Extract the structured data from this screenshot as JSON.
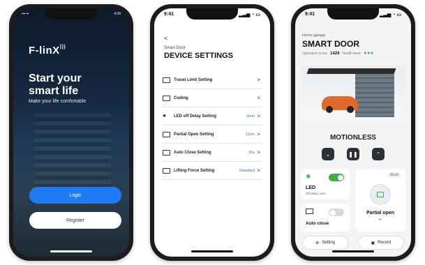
{
  "login": {
    "status_time": "4:39",
    "logo": "F-linX",
    "headline_line1": "Start your",
    "headline_line2": "smart life",
    "subline": "Make your life comfortable",
    "login_button": "Login",
    "register_button": "Register"
  },
  "device_settings": {
    "status_time": "9:41",
    "back": "<",
    "subtitle": "Smart Door",
    "title": "DEVICE SETTINGS",
    "items": [
      {
        "label": "Travel Limit Setting",
        "value": "",
        "icon": "garage-icon"
      },
      {
        "label": "Coding",
        "value": "",
        "icon": "garage-icon"
      },
      {
        "label": "LED off Delay Setting",
        "value": "3min",
        "icon": "bulb-icon"
      },
      {
        "label": "Partial Open Setting",
        "value": "12cm",
        "icon": "garage-icon"
      },
      {
        "label": "Auto Close Setting",
        "value": "15s",
        "icon": "garage-icon"
      },
      {
        "label": "Lifting Force Setting",
        "value": "Standard",
        "icon": "garage-icon"
      }
    ]
  },
  "smart_door": {
    "status_time": "9:41",
    "subtitle": "Home garage",
    "title": "SMART DOOR",
    "cycles_label": "Operated cycles",
    "cycles_value": "1424",
    "health_label": "Health level",
    "health_stars": "★★★",
    "state": "MOTIONLESS",
    "led_label": "LED",
    "led_sub": "Off delay 1min",
    "auto_close_label": "Auto close",
    "partial_label": "Partial open",
    "partial_sub": "on",
    "partial_value": "30cm",
    "setting_button": "Setting",
    "record_button": "Record",
    "accent": "#3cb043"
  }
}
